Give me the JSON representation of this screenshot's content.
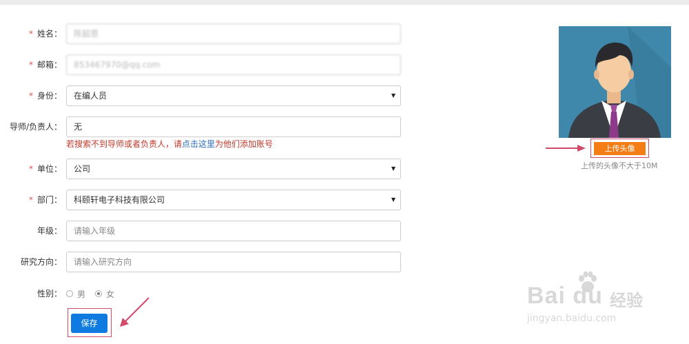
{
  "form": {
    "name": {
      "label": "姓名：",
      "required": "*",
      "value": "陈韶恩"
    },
    "email": {
      "label": "邮箱：",
      "required": "*",
      "value": "853467970@qq.com"
    },
    "identity": {
      "label": "身份：",
      "required": "*",
      "value": "在编人员"
    },
    "mentor": {
      "label": "导师/负责人：",
      "value": "无"
    },
    "hint": {
      "before": "若搜索不到导师或者负责人，请",
      "link": "点击这里",
      "after": "为他们添加账号"
    },
    "unit": {
      "label": "单位：",
      "required": "*",
      "value": "公司"
    },
    "dept": {
      "label": "部门：",
      "required": "*",
      "value": "科颐轩电子科技有限公司"
    },
    "grade": {
      "label": "年级：",
      "placeholder": "请输入年级"
    },
    "research": {
      "label": "研究方向：",
      "placeholder": "请输入研究方向"
    },
    "gender": {
      "label": "性别：",
      "options": [
        "男",
        "女"
      ],
      "selected": "女"
    },
    "save_label": "保存"
  },
  "avatar": {
    "upload_label": "上传头像",
    "upload_hint": "上传的头像不大于10M"
  },
  "watermark": {
    "logo": "Bai du",
    "cn": "经验",
    "url": "jingyan.baidu.com"
  },
  "colors": {
    "primary": "#0f7be0",
    "upload": "#f47d16",
    "required": "#d9534f",
    "hint": "#c0392b",
    "link": "#2a6ebb",
    "annotation": "#d04a6a"
  }
}
